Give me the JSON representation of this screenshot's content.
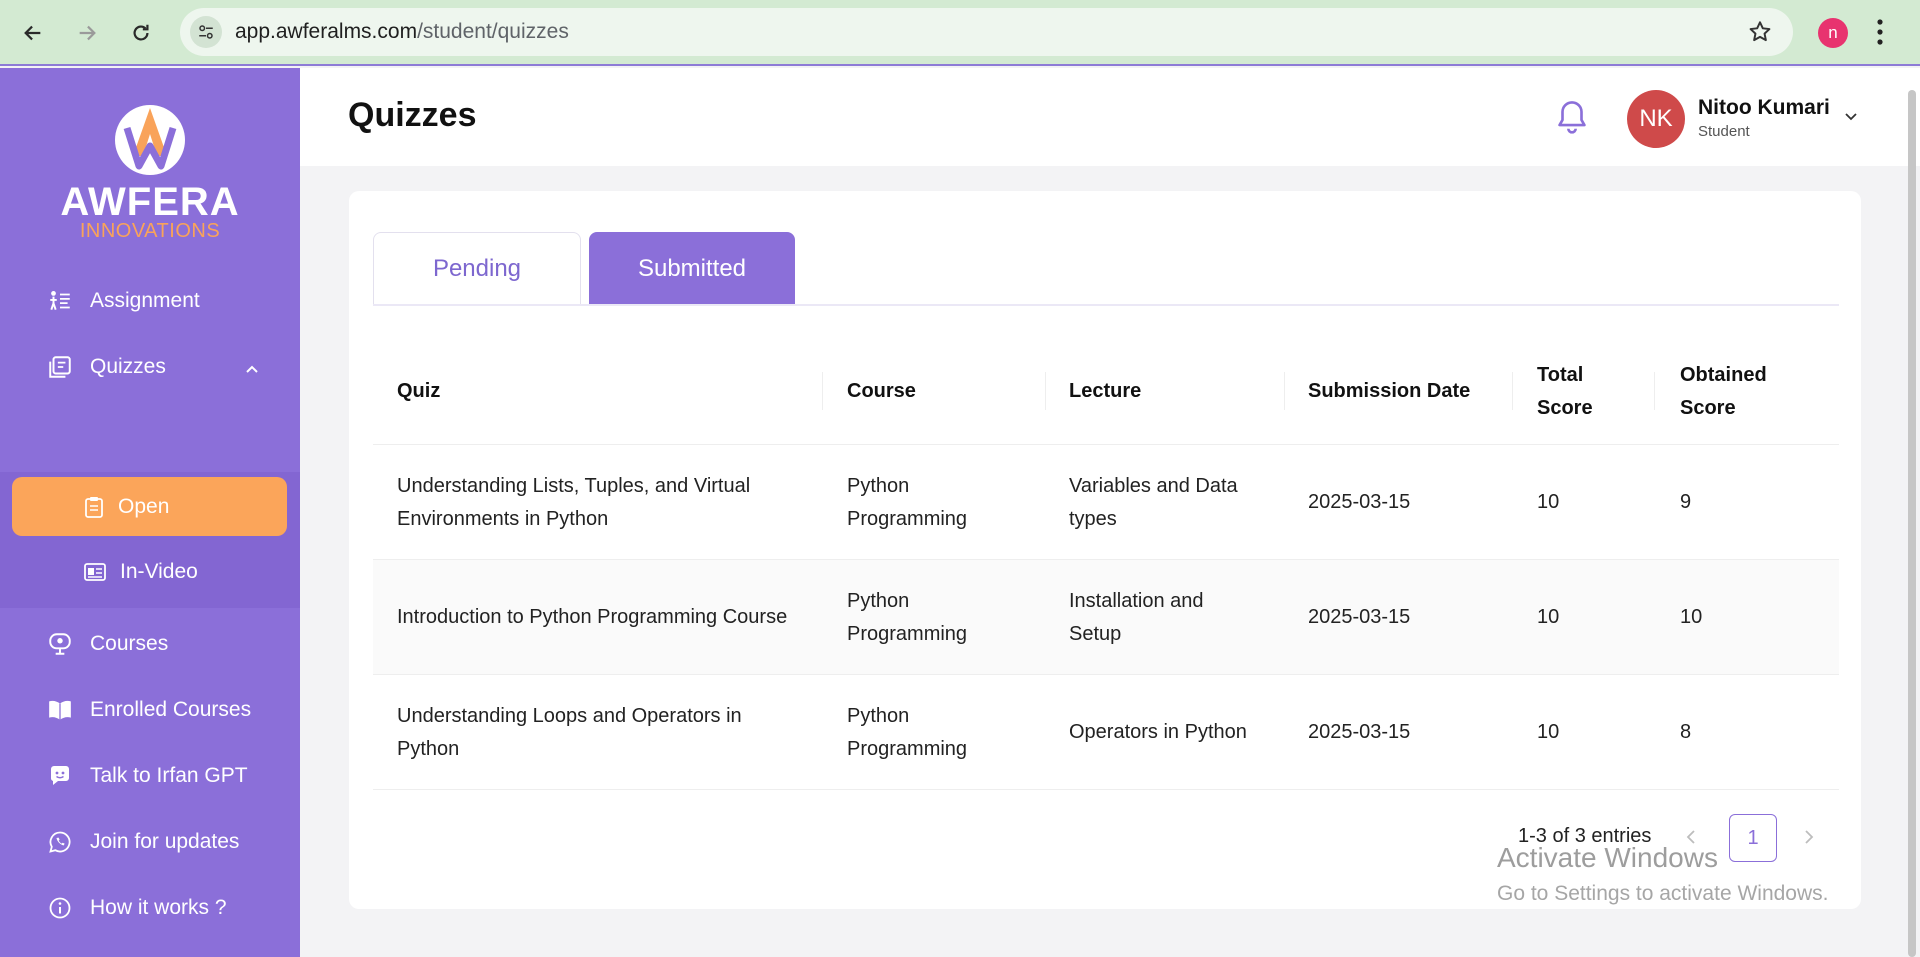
{
  "browser": {
    "url_host": "app.awferalms.com",
    "url_path": "/student/quizzes",
    "profile_initial": "n"
  },
  "brand": {
    "name": "AWFERA",
    "tagline": "INNOVATIONS"
  },
  "sidebar": {
    "items": [
      {
        "label": "Assignment",
        "icon": "assignment-icon"
      },
      {
        "label": "Quizzes",
        "icon": "quiz-icon"
      },
      {
        "label": "Open",
        "icon": "clipboard-icon"
      },
      {
        "label": "In-Video",
        "icon": "video-card-icon"
      },
      {
        "label": "Courses",
        "icon": "courses-icon"
      },
      {
        "label": "Enrolled Courses",
        "icon": "book-icon"
      },
      {
        "label": "Talk to Irfan GPT",
        "icon": "chat-bot-icon"
      },
      {
        "label": "Join for updates",
        "icon": "whatsapp-icon"
      },
      {
        "label": "How it works ?",
        "icon": "info-icon"
      }
    ]
  },
  "header": {
    "title": "Quizzes",
    "user": {
      "initials": "NK",
      "name": "Nitoo Kumari",
      "role": "Student"
    }
  },
  "tabs": [
    {
      "label": "Pending",
      "active": false
    },
    {
      "label": "Submitted",
      "active": true
    }
  ],
  "table": {
    "columns": [
      "Quiz",
      "Course",
      "Lecture",
      "Submission Date",
      "Total Score",
      "Obtained Score"
    ],
    "rows": [
      [
        "Understanding Lists, Tuples, and Virtual Environments in Python",
        "Python Programming",
        "Variables and Data types",
        "2025-03-15",
        "10",
        "9"
      ],
      [
        "Introduction to Python Programming Course",
        "Python Programming",
        "Installation and Setup",
        "2025-03-15",
        "10",
        "10"
      ],
      [
        "Understanding Loops and Operators in Python",
        "Python Programming",
        "Operators in Python",
        "2025-03-15",
        "10",
        "8"
      ]
    ]
  },
  "pagination": {
    "summary": "1-3 of 3 entries",
    "current_page": "1"
  },
  "watermark": {
    "title": "Activate Windows",
    "subtitle": "Go to Settings to activate Windows."
  },
  "colors": {
    "sidebar": "#8b6fd9",
    "accent_orange": "#fba55a",
    "avatar": "#cf4a4a"
  }
}
